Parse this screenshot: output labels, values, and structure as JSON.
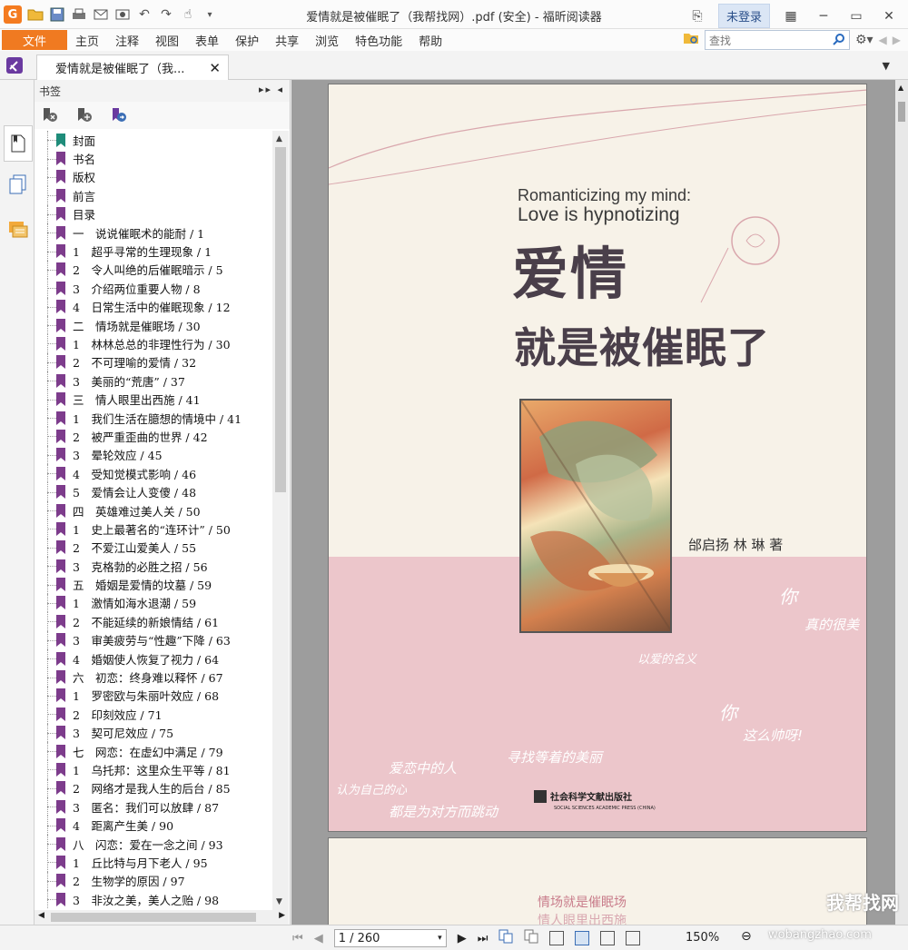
{
  "window": {
    "title": "爱情就是被催眠了（我帮找网）.pdf (安全) - 福昕阅读器",
    "login_label": "未登录"
  },
  "menu": {
    "file": "文件",
    "items": [
      "主页",
      "注释",
      "视图",
      "表单",
      "保护",
      "共享",
      "浏览",
      "特色功能",
      "帮助"
    ]
  },
  "search": {
    "placeholder": "查找"
  },
  "tab": {
    "label": "爱情就是被催眠了（我..."
  },
  "bookmarks": {
    "header": "书签",
    "items": [
      "封面",
      "书名",
      "版权",
      "前言",
      "目录",
      "一　说说催眠术的能耐 / 1",
      "1　超乎寻常的生理现象 / 1",
      "2　令人叫绝的后催眠暗示 / 5",
      "3　介绍两位重要人物 / 8",
      "4　日常生活中的催眠现象 / 12",
      "二　情场就是催眠场 / 30",
      "1　林林总总的非理性行为 / 30",
      "2　不可理喻的爱情 / 32",
      "3　美丽的“荒唐” / 37",
      "三　情人眼里出西施 / 41",
      "1　我们生活在臆想的情境中 / 41",
      "2　被严重歪曲的世界 / 42",
      "3　晕轮效应 / 45",
      "4　受知觉模式影响 / 46",
      "5　爱情会让人变傻 / 48",
      "四　英雄难过美人关 / 50",
      "1　史上最著名的“连环计” / 50",
      "2　不爱江山爱美人 / 55",
      "3　克格勃的必胜之招 / 56",
      "五　婚姻是爱情的坟墓 / 59",
      "1　激情如海水退潮 / 59",
      "2　不能延续的新娘情结 / 61",
      "3　审美疲劳与“性趣”下降 / 63",
      "4　婚姻使人恢复了视力 / 64",
      "六　初恋：终身难以释怀 / 67",
      "1　罗密欧与朱丽叶效应 / 68",
      "2　印刻效应 / 71",
      "3　契可尼效应 / 75",
      "七　网恋：在虚幻中满足 / 79",
      "1　乌托邦：这里众生平等 / 81",
      "2　网络才是我人生的后台 / 85",
      "3　匿名：我们可以放肆 / 87",
      "4　距离产生美 / 90",
      "八　闪恋：爱在一念之间 / 93",
      "1　丘比特与月下老人 / 95",
      "2　生物学的原因 / 97",
      "3　非汝之美，美人之贻 / 98"
    ]
  },
  "cover": {
    "en_line1": "Romanticizing my mind:",
    "en_line2": "Love is hypnotizing",
    "title_line1": "爱情",
    "title_line2": "就是被催眠了",
    "author": "邰启扬  林 琳  著",
    "publisher": "社会科学文献出版社",
    "publisher_en": "SOCIAL SCIENCES ACADEMIC PRESS (CHINA)",
    "handwriting": [
      "你",
      "真的很美",
      "以爱的名义",
      "你",
      "这么帅呀!",
      "爱恋中的人",
      "寻找等着的美丽",
      "认为自己的心",
      "都是为对方而跳动"
    ]
  },
  "page2": {
    "line1": "情场就是催眠场",
    "line2": "情人眼里出西施"
  },
  "status": {
    "page_value": "1 / 260",
    "zoom": "150%"
  },
  "watermark": {
    "cn": "我帮找网",
    "en": "wobangzhao.com"
  },
  "colors": {
    "accent_orange": "#f07a21",
    "bookmark_flag": "#7d3c8c",
    "bookmark_flag_first": "#1f8c7a",
    "cover_pink": "#ecc6cb"
  }
}
